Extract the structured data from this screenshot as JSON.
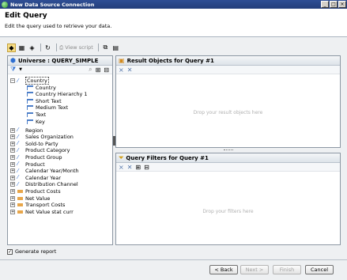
{
  "window": {
    "title": "New Data Source Connection"
  },
  "header": {
    "title": "Edit Query",
    "subtitle": "Edit the query used to retrieve your data."
  },
  "toolbar": {
    "view_script_label": "View script"
  },
  "universe": {
    "title": "Universe : QUERY_SIMPLE",
    "tree": [
      {
        "label": "Country",
        "type": "dim",
        "expanded": true,
        "selected": true
      },
      {
        "label": "Country",
        "type": "attr"
      },
      {
        "label": "Country Hierarchy 1",
        "type": "attr"
      },
      {
        "label": "Short Text",
        "type": "attr"
      },
      {
        "label": "Medium Text",
        "type": "attr"
      },
      {
        "label": "Text",
        "type": "attr"
      },
      {
        "label": "Key",
        "type": "attr"
      },
      {
        "label": "Region",
        "type": "dim"
      },
      {
        "label": "Sales Organization",
        "type": "dim"
      },
      {
        "label": "Sold-to Party",
        "type": "dim"
      },
      {
        "label": "Product Category",
        "type": "dim"
      },
      {
        "label": "Product Group",
        "type": "dim"
      },
      {
        "label": "Product",
        "type": "dim"
      },
      {
        "label": "Calendar Year/Month",
        "type": "dim"
      },
      {
        "label": "Calendar Year",
        "type": "dim"
      },
      {
        "label": "Distribution Channel",
        "type": "dim"
      },
      {
        "label": "Product Costs",
        "type": "meas"
      },
      {
        "label": "Net Value",
        "type": "meas"
      },
      {
        "label": "Transport Costs",
        "type": "meas"
      },
      {
        "label": "Net Value stat curr",
        "type": "meas"
      }
    ]
  },
  "result_objects": {
    "title": "Result Objects for Query #1",
    "hint": "Drop your result objects here"
  },
  "query_filters": {
    "title": "Query Filters for Query #1",
    "hint": "Drop your filters here"
  },
  "generate_report": {
    "label": "Generate report",
    "checked": true
  },
  "buttons": {
    "back": "< Back",
    "next": "Next >",
    "finish": "Finish",
    "cancel": "Cancel"
  }
}
